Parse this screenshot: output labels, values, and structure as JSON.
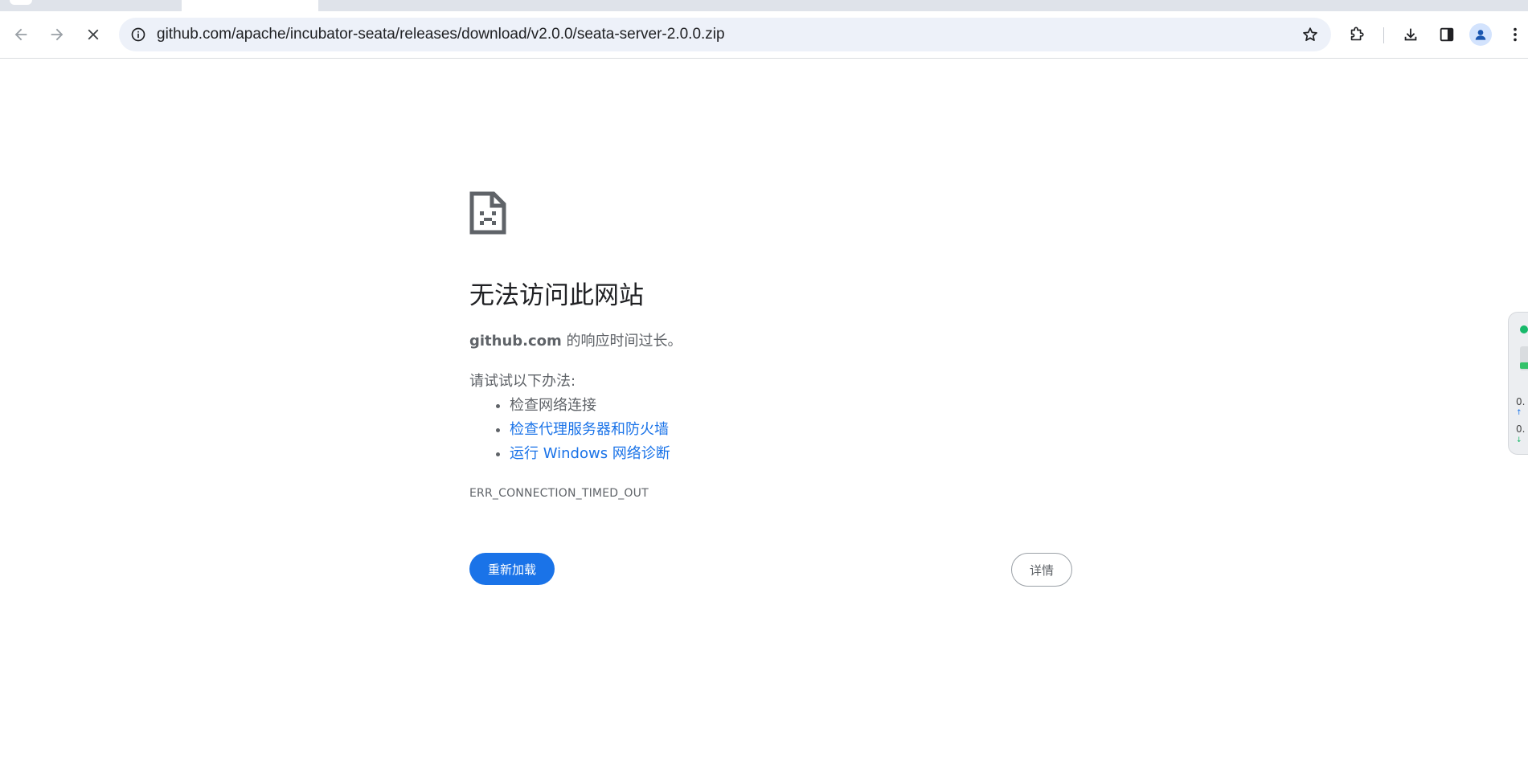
{
  "browser": {
    "url": "github.com/apache/incubator-seata/releases/download/v2.0.0/seata-server-2.0.0.zip"
  },
  "error_page": {
    "title": "无法访问此网站",
    "host": "github.com",
    "description_suffix": " 的响应时间过长。",
    "try_heading": "请试试以下办法:",
    "suggestions": [
      "检查网络连接",
      "检查代理服务器和防火墙",
      "运行 Windows 网络诊断"
    ],
    "error_code": "ERR_CONNECTION_TIMED_OUT",
    "reload_label": "重新加载",
    "details_label": "详情"
  },
  "widget": {
    "upload_value": "0.",
    "download_value": "0."
  },
  "colors": {
    "link": "#1a73e8",
    "primary_button": "#1a73e8",
    "status_dot": "#17b96a"
  },
  "icons": {
    "back": "arrow-left-icon",
    "forward": "arrow-right-icon",
    "stop": "close-icon",
    "site_info": "info-icon",
    "bookmark": "star-icon",
    "extensions": "puzzle-icon",
    "downloads": "download-icon",
    "side_panel": "side-panel-icon",
    "profile": "person-icon",
    "menu": "kebab-menu-icon",
    "error": "sad-page-icon"
  }
}
